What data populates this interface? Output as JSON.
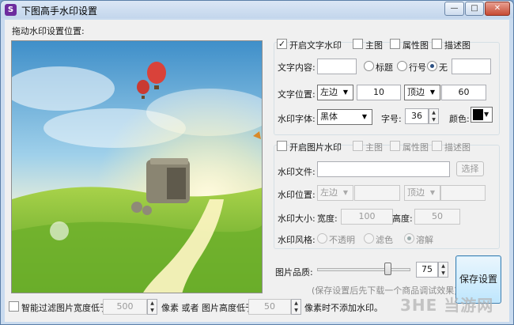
{
  "window": {
    "title": "下图高手水印设置",
    "icon_glyph": "S",
    "controls": {
      "minimize": "—",
      "maximize": "□",
      "close": "✕"
    }
  },
  "preview": {
    "label": "拖动水印设置位置:"
  },
  "text_watermark": {
    "enable_label": "开启文字水印",
    "enable_checked": true,
    "targets": [
      {
        "label": "主图",
        "checked": false
      },
      {
        "label": "属性图",
        "checked": false
      },
      {
        "label": "描述图",
        "checked": false
      }
    ],
    "content_label": "文字内容:",
    "content_value": "",
    "content_options": [
      {
        "label": "标题",
        "selected": false
      },
      {
        "label": "行号",
        "selected": false
      },
      {
        "label": "无",
        "selected": true
      }
    ],
    "content_extra_value": "",
    "position_label": "文字位置:",
    "h_align": "左边",
    "h_offset": "10",
    "v_align": "顶边",
    "v_offset": "60",
    "font_label": "水印字体:",
    "font_value": "黑体",
    "size_label": "字号:",
    "size_value": "36",
    "color_label": "颜色:",
    "color_hex": "#000000"
  },
  "image_watermark": {
    "enable_label": "开启图片水印",
    "enable_checked": false,
    "targets": [
      {
        "label": "主图",
        "checked": false
      },
      {
        "label": "属性图",
        "checked": false
      },
      {
        "label": "描述图",
        "checked": false
      }
    ],
    "file_label": "水印文件:",
    "file_value": "",
    "browse_label": "选择",
    "position_label": "水印位置:",
    "h_align": "左边",
    "h_offset": "",
    "v_align": "顶边",
    "v_offset": "",
    "size_label": "水印大小:",
    "width_label": "宽度:",
    "width_value": "100",
    "height_label": "高度:",
    "height_value": "50",
    "style_label": "水印风格:",
    "styles": [
      {
        "label": "不透明",
        "selected": false
      },
      {
        "label": "滤色",
        "selected": false
      },
      {
        "label": "溶解",
        "selected": true
      }
    ]
  },
  "quality": {
    "label": "图片品质:",
    "value": "75",
    "slider_fraction": 0.75,
    "hint": "(保存设置后先下载一个商品调试效果)"
  },
  "save_button": "保存设置",
  "filter": {
    "checked": false,
    "label_prefix": "智能过滤图片宽度低于:",
    "width_value": "500",
    "unit_or": "像素 或者 图片高度低于:",
    "height_value": "50",
    "suffix": "像素时不添加水印。"
  },
  "site_watermark": {
    "en": "3HE",
    "cn": "当游网"
  },
  "colors": {
    "accent": "#3c7fb1",
    "window_frame": "#c9dbef",
    "client_bg": "#f0f0f0"
  }
}
